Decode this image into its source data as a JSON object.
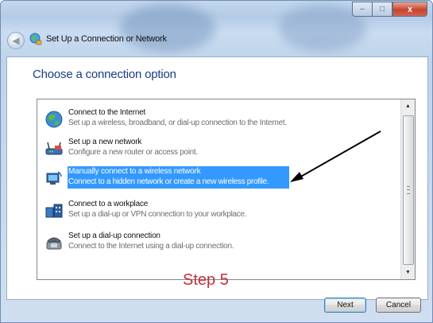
{
  "window": {
    "title": "Set Up a Connection or Network",
    "controls": {
      "minimize": "–",
      "maximize": "□",
      "close": "x"
    }
  },
  "header": {
    "heading": "Choose a connection option"
  },
  "options": [
    {
      "title": "Connect to the Internet",
      "desc": "Set up a wireless, broadband, or dial-up connection to the Internet.",
      "icon": "globe-network-icon",
      "selected": false
    },
    {
      "title": "Set up a new network",
      "desc": "Configure a new router or access point.",
      "icon": "router-icon",
      "selected": false
    },
    {
      "title": "Manually connect to a wireless network",
      "desc": "Connect to a hidden network or create a new wireless profile.",
      "icon": "wireless-computer-icon",
      "selected": true
    },
    {
      "title": "Connect to a workplace",
      "desc": "Set up a dial-up or VPN connection to your workplace.",
      "icon": "workplace-icon",
      "selected": false
    },
    {
      "title": "Set up a dial-up connection",
      "desc": "Connect to the Internet using a dial-up connection.",
      "icon": "telephone-icon",
      "selected": false
    }
  ],
  "annotation": {
    "step_label": "Step 5",
    "color": "#c1323a"
  },
  "buttons": {
    "next": "Next",
    "cancel": "Cancel"
  },
  "colors": {
    "selection": "#3399ff",
    "heading": "#1a3d82"
  }
}
